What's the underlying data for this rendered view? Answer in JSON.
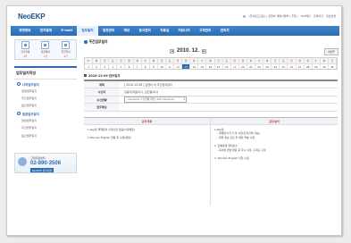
{
  "header": {
    "logo": "NeoEKP",
    "user_name": "(주)네오드림스 | 김현아 개발사업부 | 주임 |",
    "links": [
      "EKP메인",
      "홈페이지",
      "정보변경"
    ]
  },
  "gnb": {
    "items": [
      "경영정보",
      "전자결재",
      "E-mail",
      "업무일지",
      "일정관리",
      "메모",
      "문서관리",
      "자료실",
      "커뮤니티",
      "고객관리",
      "관리자"
    ],
    "active_index": 3
  },
  "quick": [
    {
      "label": "전자결재",
      "count": "1건"
    },
    {
      "label": "받은쪽지",
      "count": "1건"
    },
    {
      "label": "업무일지",
      "count": "4건"
    }
  ],
  "left_menu": {
    "title": "업무일지작성",
    "group1": "나의업무일지",
    "group1_items": [
      "일일업무일지",
      "주간업무일지",
      "월간업무일지"
    ],
    "group2": "팀원업무일지",
    "group2_items": [
      "일일업무일지",
      "주간업무일지",
      "월간업무일지"
    ]
  },
  "support": {
    "label": "고객지원센터",
    "phone": "02-890-3506",
    "note": "월~금 9:00~18:00",
    "remote": "NeoEKP 원격지원"
  },
  "main": {
    "section_title": "주간업무일지",
    "month": "2010. 12.",
    "month_button": "이번주",
    "weekdays": [
      "수",
      "목",
      "금",
      "토",
      "일",
      "월",
      "화",
      "수",
      "목",
      "금",
      "토",
      "일",
      "월",
      "화",
      "수",
      "목",
      "금",
      "토",
      "일",
      "월",
      "화",
      "수",
      "목",
      "금",
      "토",
      "일",
      "월",
      "화",
      "수",
      "목",
      "금"
    ],
    "days": [
      "1",
      "2",
      "3",
      "4",
      "5",
      "6",
      "7",
      "8",
      "9",
      "10",
      "11",
      "12",
      "13",
      "14",
      "15",
      "16",
      "17",
      "18",
      "19",
      "20",
      "21",
      "22",
      "23",
      "24",
      "25",
      "26",
      "27",
      "28",
      "29",
      "30",
      "31"
    ],
    "today_index": 12,
    "detail_title": "2010-12-09 업무일지",
    "info": {
      "title_label": "제목",
      "title_value": "[ 2010-12-06 ] 김현아 의 주간업무일지",
      "receiver_label": "수신자",
      "receiver_value": "김용우/대표이사, 김진용/이사",
      "ref_label": "수신현황",
      "ref_value": "xxxxxxxx 수신현황 확인 (1/2) xxxxxxxx",
      "memo_label": "업무메모",
      "memo_value": ""
    },
    "plan_header": "금주계획",
    "result_header": "금주실적",
    "plan_lines": [
      "1.ekp툴 결재문서 수정사항 있음(수정예정)",
      "",
      "2.Wonder English 연동 후 수정(예정)"
    ],
    "result_lines": [
      "1.ekp툴",
      "- 결재문서 추가 및 수정(조직검색 기능)",
      "- 연결 정보 검토 후 해당 부분 수정",
      "",
      "2. 현황표에 유지보수",
      "- 회사에 반영 완료 후 다시 수정, 출력도 수정",
      "",
      "3. Wonder English 사전 수정"
    ]
  }
}
